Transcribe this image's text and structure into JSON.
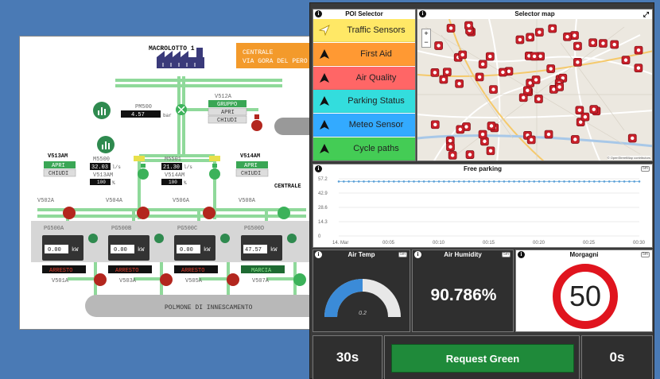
{
  "scada": {
    "macrolotto_label": "MACROLOTTO 1",
    "centrale_line1": "CENTRALE",
    "centrale_line2": "VIA GORA DEL PERO",
    "centrale_right": "CENTRALE",
    "pm500": {
      "name": "PM500",
      "value": "4.57",
      "unit": "bar"
    },
    "v512a": {
      "name": "V512A",
      "status": "GRUPPO",
      "btn_open": "APRI",
      "btn_close": "CHIUDI"
    },
    "v513am": {
      "name": "V513AM",
      "btn_open": "APRI",
      "btn_close": "CHIUDI"
    },
    "v514am": {
      "name": "V514AM",
      "btn_open": "APRI",
      "btn_close": "CHIUDI"
    },
    "m5500": {
      "name": "M5500",
      "value": "32.03",
      "unit": "l/s"
    },
    "v513am_pct": {
      "name": "V513AM",
      "value": "100",
      "unit": "%"
    },
    "m5501": {
      "name": "M5501",
      "value": "21.30",
      "unit": "l/s"
    },
    "v514am_pct": {
      "name": "V514AM",
      "value": "100",
      "unit": "%"
    },
    "valves_top": [
      "V502A",
      "V504A",
      "V506A",
      "V508A"
    ],
    "pumps": [
      {
        "name": "PG500A",
        "value": "0.00",
        "unit": "kW",
        "status": "ARRESTO",
        "valve": "V501A"
      },
      {
        "name": "PG500B",
        "value": "0.00",
        "unit": "kW",
        "status": "ARRESTO",
        "valve": "V503A"
      },
      {
        "name": "PG500C",
        "value": "0.00",
        "unit": "kW",
        "status": "ARRESTO",
        "valve": "V505A"
      },
      {
        "name": "PG500D",
        "value": "47.57",
        "unit": "kW",
        "status": "MARCIA",
        "valve": "V507A"
      }
    ],
    "polmone": "POLMONE DI INNESCAMENTO"
  },
  "dashboard": {
    "poi_selector": {
      "title": "POI Selector",
      "items": [
        {
          "label": "Traffic Sensors",
          "color": "#ffe866",
          "icon": "cursor-icon"
        },
        {
          "label": "First Aid",
          "color": "#ff9933",
          "icon": "arrow-icon"
        },
        {
          "label": "Air Quality",
          "color": "#ff6666",
          "icon": "arrow-icon"
        },
        {
          "label": "Parking Status",
          "color": "#33dddd",
          "icon": "arrow-icon"
        },
        {
          "label": "Meteo Sensor",
          "color": "#33aaff",
          "icon": "arrow-icon"
        },
        {
          "label": "Cycle paths",
          "color": "#44cc55",
          "icon": "arrow-icon"
        }
      ]
    },
    "map": {
      "title": "Selector map",
      "zoom_in": "+",
      "zoom_out": "−",
      "attribution": "© OpenStreetMap contributors"
    },
    "free_parking": {
      "title": "Free parking",
      "tag": "5m",
      "yticks": [
        "57.2",
        "42.9",
        "28.6",
        "14.3",
        "0"
      ],
      "xticks": [
        "14. Mar",
        "00:05",
        "00:10",
        "00:15",
        "00:20",
        "00:25",
        "00:30"
      ]
    },
    "air_temp": {
      "title": "Air Temp",
      "tag": "5m",
      "value": "0.2",
      "fraction": 0.5
    },
    "air_humidity": {
      "title": "Air Humidity",
      "tag": "5m",
      "value": "90.786%"
    },
    "morgagni": {
      "title": "Morgagni",
      "tag": "5m",
      "value": "50"
    },
    "timer_left": "30s",
    "request_button": "Request Green",
    "timer_right": "0s",
    "colors": {
      "accent_green": "#1f8a3a",
      "speed_red": "#e0141e"
    }
  },
  "chart_data": {
    "type": "line",
    "title": "Free parking",
    "x": [
      "14. Mar",
      "00:05",
      "00:10",
      "00:15",
      "00:20",
      "00:25",
      "00:30"
    ],
    "series": [
      {
        "values": [
          54.5,
          54.5,
          54.5,
          54.5,
          54.5,
          54.5,
          54.5
        ]
      }
    ],
    "ylim": [
      0,
      57.2
    ]
  }
}
